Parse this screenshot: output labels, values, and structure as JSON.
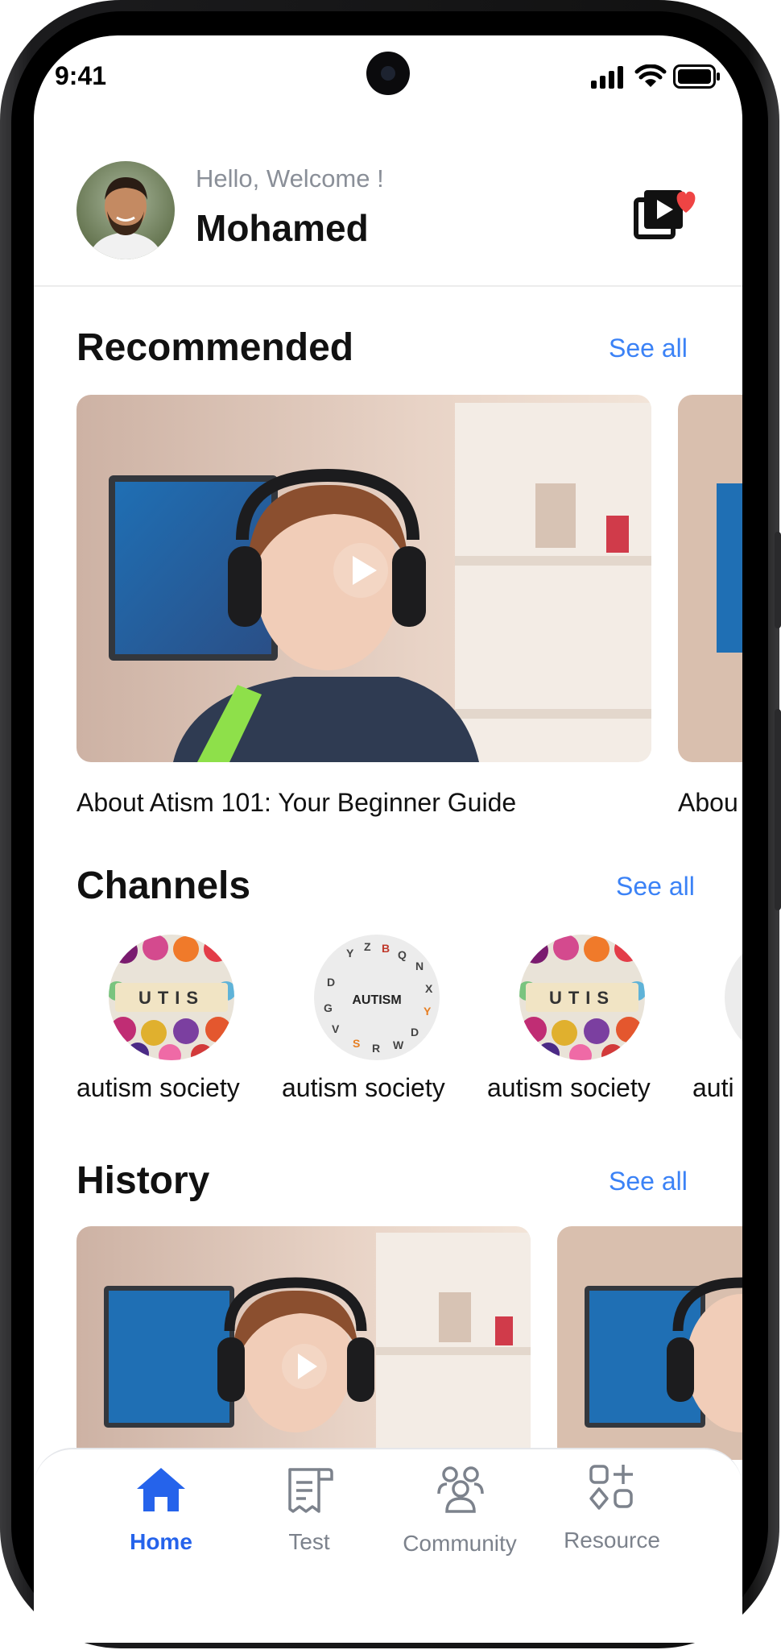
{
  "status_bar": {
    "time": "9:41"
  },
  "header": {
    "greeting": "Hello, Welcome !",
    "user_name": "Mohamed",
    "video_icon": "video-library-heart-icon"
  },
  "recommended": {
    "title": "Recommended",
    "see_all": "See all",
    "items": [
      {
        "title": "About Atism 101: Your Beginner Guide"
      },
      {
        "title": "Abou"
      }
    ]
  },
  "channels": {
    "title": "Channels",
    "see_all": "See all",
    "items": [
      {
        "name": "autism society",
        "logo_text": "UTIS"
      },
      {
        "name": "autism society",
        "logo_text": "AUTISM"
      },
      {
        "name": "autism society",
        "logo_text": "UTIS"
      },
      {
        "name": "auti"
      }
    ]
  },
  "history": {
    "title": "History",
    "see_all": "See all"
  },
  "tab_bar": {
    "items": [
      {
        "label": "Home",
        "icon": "home-icon",
        "active": true
      },
      {
        "label": "Test",
        "icon": "test-document-icon",
        "active": false
      },
      {
        "label": "Community",
        "icon": "community-icon",
        "active": false
      },
      {
        "label": "Resource",
        "icon": "resource-icon",
        "active": false
      }
    ]
  },
  "colors": {
    "accent": "#3b82f6",
    "active_tab": "#2563eb",
    "heart": "#ef4444"
  }
}
